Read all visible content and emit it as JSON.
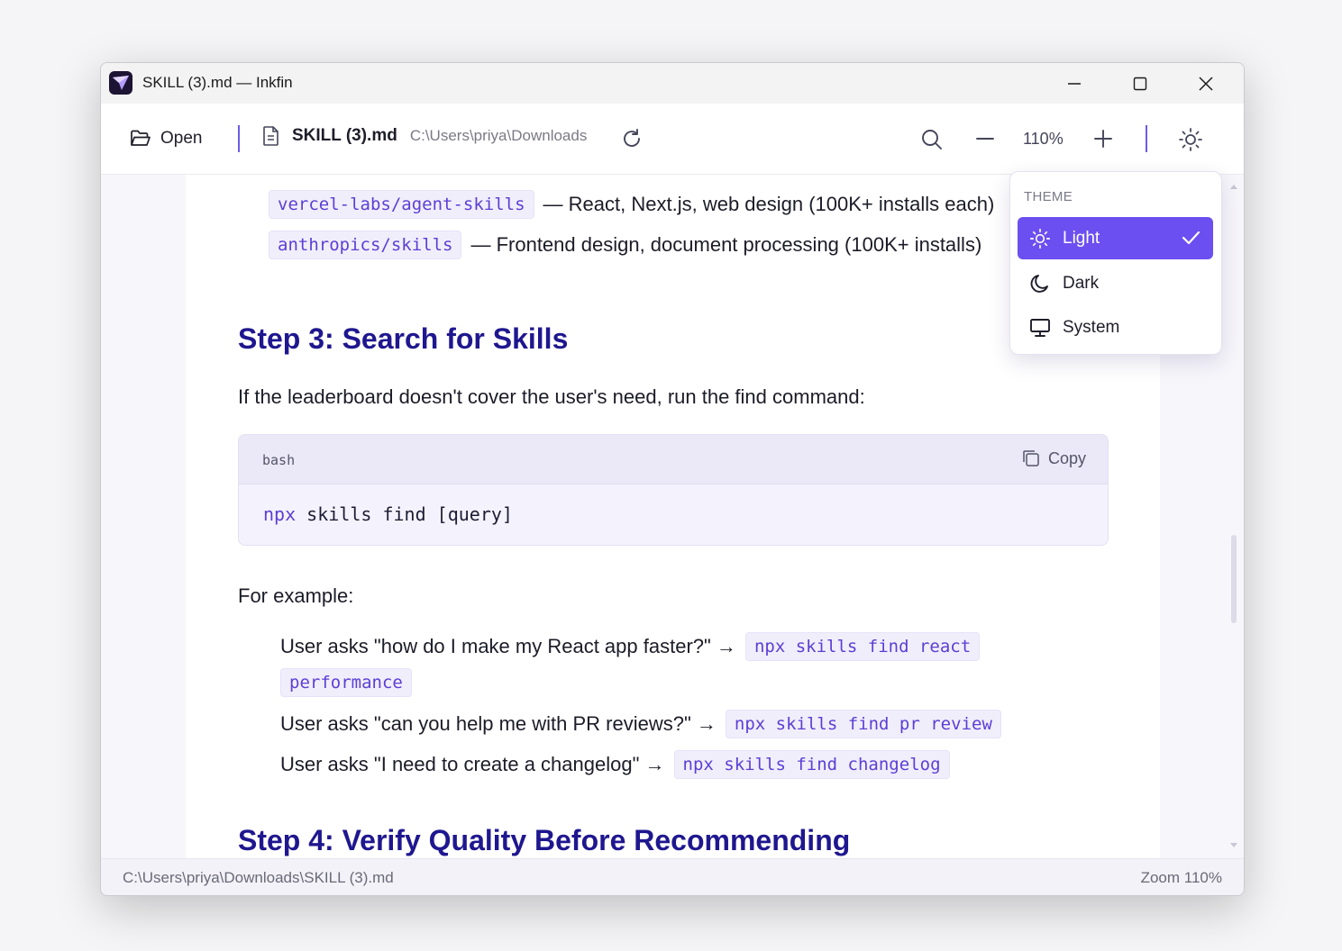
{
  "window": {
    "title": "SKILL (3).md — Inkfin"
  },
  "toolbar": {
    "open_label": "Open",
    "doc_name": "SKILL (3).md",
    "doc_path": "C:\\Users\\priya\\Downloads",
    "zoom": "110%"
  },
  "content": {
    "list1": [
      {
        "code": "vercel-labs/agent-skills",
        "text": "— React, Next.js, web design (100K+ installs each)"
      },
      {
        "code": "anthropics/skills",
        "text": "— Frontend design, document processing (100K+ installs)"
      }
    ],
    "step3_heading": "Step 3: Search for Skills",
    "step3_para": "If the leaderboard doesn't cover the user's need, run the find command:",
    "codeblock": {
      "lang": "bash",
      "copy_label": "Copy",
      "cmd": "npx",
      "rest": " skills find [query]"
    },
    "example_intro": "For example:",
    "examples": [
      {
        "text": "User asks \"how do I make my React app faster?\" →",
        "code": "npx skills find react",
        "code2": "performance"
      },
      {
        "text": "User asks \"can you help me with PR reviews?\" →",
        "code": "npx skills find pr review"
      },
      {
        "text": "User asks \"I need to create a changelog\" →",
        "code": "npx skills find changelog"
      }
    ],
    "step4_heading": "Step 4: Verify Quality Before Recommending"
  },
  "status": {
    "path": "C:\\Users\\priya\\Downloads\\SKILL (3).md",
    "zoom": "Zoom 110%"
  },
  "theme_menu": {
    "header": "THEME",
    "items": [
      {
        "label": "Light",
        "icon": "sun-icon",
        "selected": true
      },
      {
        "label": "Dark",
        "icon": "moon-icon",
        "selected": false
      },
      {
        "label": "System",
        "icon": "monitor-icon",
        "selected": false
      }
    ]
  },
  "colors": {
    "accent": "#6b4ff0",
    "heading": "#1f178f",
    "code": "#5b3fd4"
  }
}
